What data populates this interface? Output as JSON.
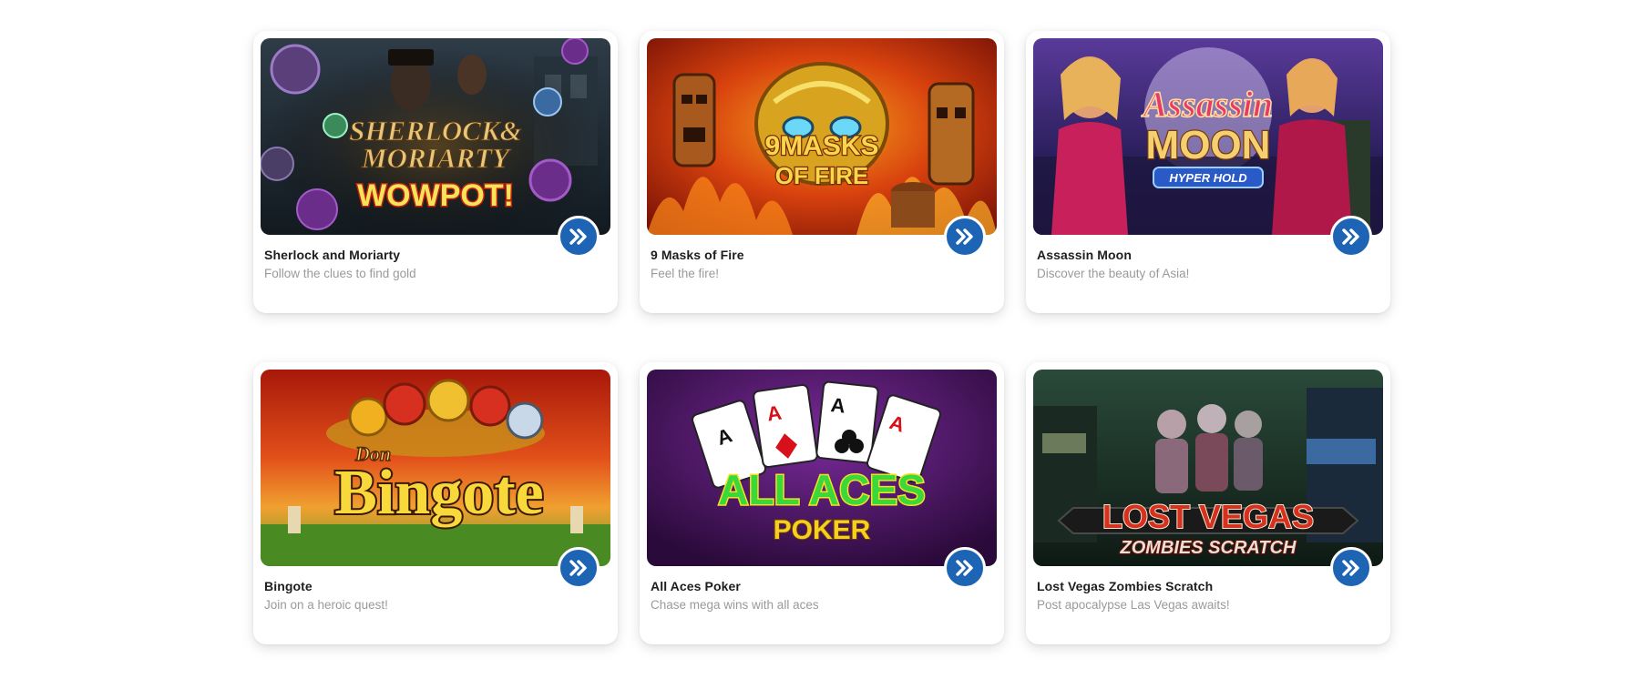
{
  "games": [
    {
      "title": "Sherlock and Moriarty",
      "subtitle": "Follow the clues to find gold",
      "thumbnail": {
        "line1": "SHERLOCK&",
        "line2": "MORIARTY",
        "line3": "WOWPOT!",
        "bg": "#1c2a33",
        "accent": "#c8922e",
        "icon": "detective-slot-art"
      }
    },
    {
      "title": "9 Masks of Fire",
      "subtitle": "Feel the fire!",
      "thumbnail": {
        "line1": "9MASKS",
        "line2": "OF FIRE",
        "bg": "#c8300c",
        "accent": "#f2c12e",
        "icon": "tiki-mask-slot-art"
      }
    },
    {
      "title": "Assassin Moon",
      "subtitle": "Discover the beauty of Asia!",
      "thumbnail": {
        "line1": "Assassin",
        "line2": "MOON",
        "line3": "HYPER HOLD",
        "bg": "#2a1f5c",
        "accent": "#e84ea0",
        "icon": "assassin-women-slot-art"
      }
    },
    {
      "title": "Bingote",
      "subtitle": "Join on a heroic quest!",
      "thumbnail": {
        "line1": "Don",
        "line2": "Bingote",
        "bg": "#d8401a",
        "accent": "#f5d63a",
        "icon": "bingo-balls-art"
      }
    },
    {
      "title": "All Aces Poker",
      "subtitle": "Chase mega wins with all aces",
      "thumbnail": {
        "line1": "ALL ACES",
        "line2": "POKER",
        "bg": "#3a0f4a",
        "accent": "#35c43a",
        "icon": "playing-cards-art"
      }
    },
    {
      "title": "Lost Vegas Zombies Scratch",
      "subtitle": "Post apocalypse Las Vegas awaits!",
      "thumbnail": {
        "line1": "LOST VEGAS",
        "line2": "ZOMBIES SCRATCH",
        "bg": "#1f3a2c",
        "accent": "#d4301f",
        "icon": "zombies-casino-art"
      }
    }
  ],
  "play_button": {
    "icon": "double-chevron-right-icon",
    "color": "#1d64b4"
  }
}
